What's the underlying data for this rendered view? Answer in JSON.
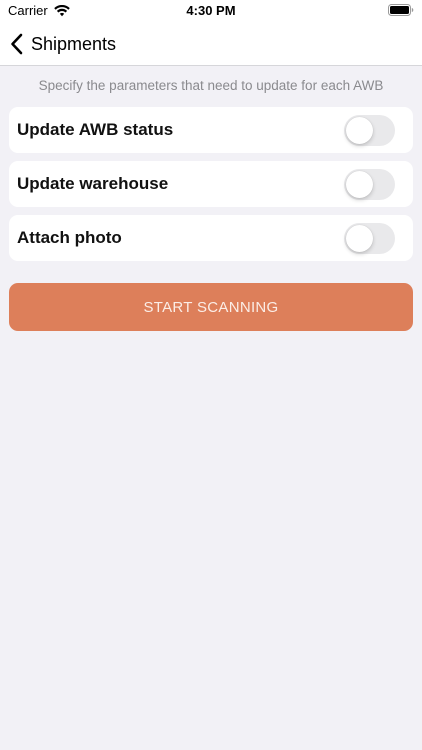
{
  "status_bar": {
    "carrier": "Carrier",
    "time": "4:30 PM",
    "wifi_icon": "wifi-icon",
    "battery_icon": "battery-icon"
  },
  "nav": {
    "back_icon": "chevron-left-icon",
    "back_label": "Shipments"
  },
  "instruction": "Specify the parameters that need to update for each AWB",
  "options": [
    {
      "label": "Update AWB status",
      "enabled": false
    },
    {
      "label": "Update warehouse",
      "enabled": false
    },
    {
      "label": "Attach photo",
      "enabled": false
    }
  ],
  "primary_button": {
    "label": "START SCANNING"
  },
  "colors": {
    "background": "#F2F1F6",
    "accent": "#DD7F5A",
    "toggle_off": "#E9E9EB",
    "secondary_text": "#8A8A8E"
  }
}
